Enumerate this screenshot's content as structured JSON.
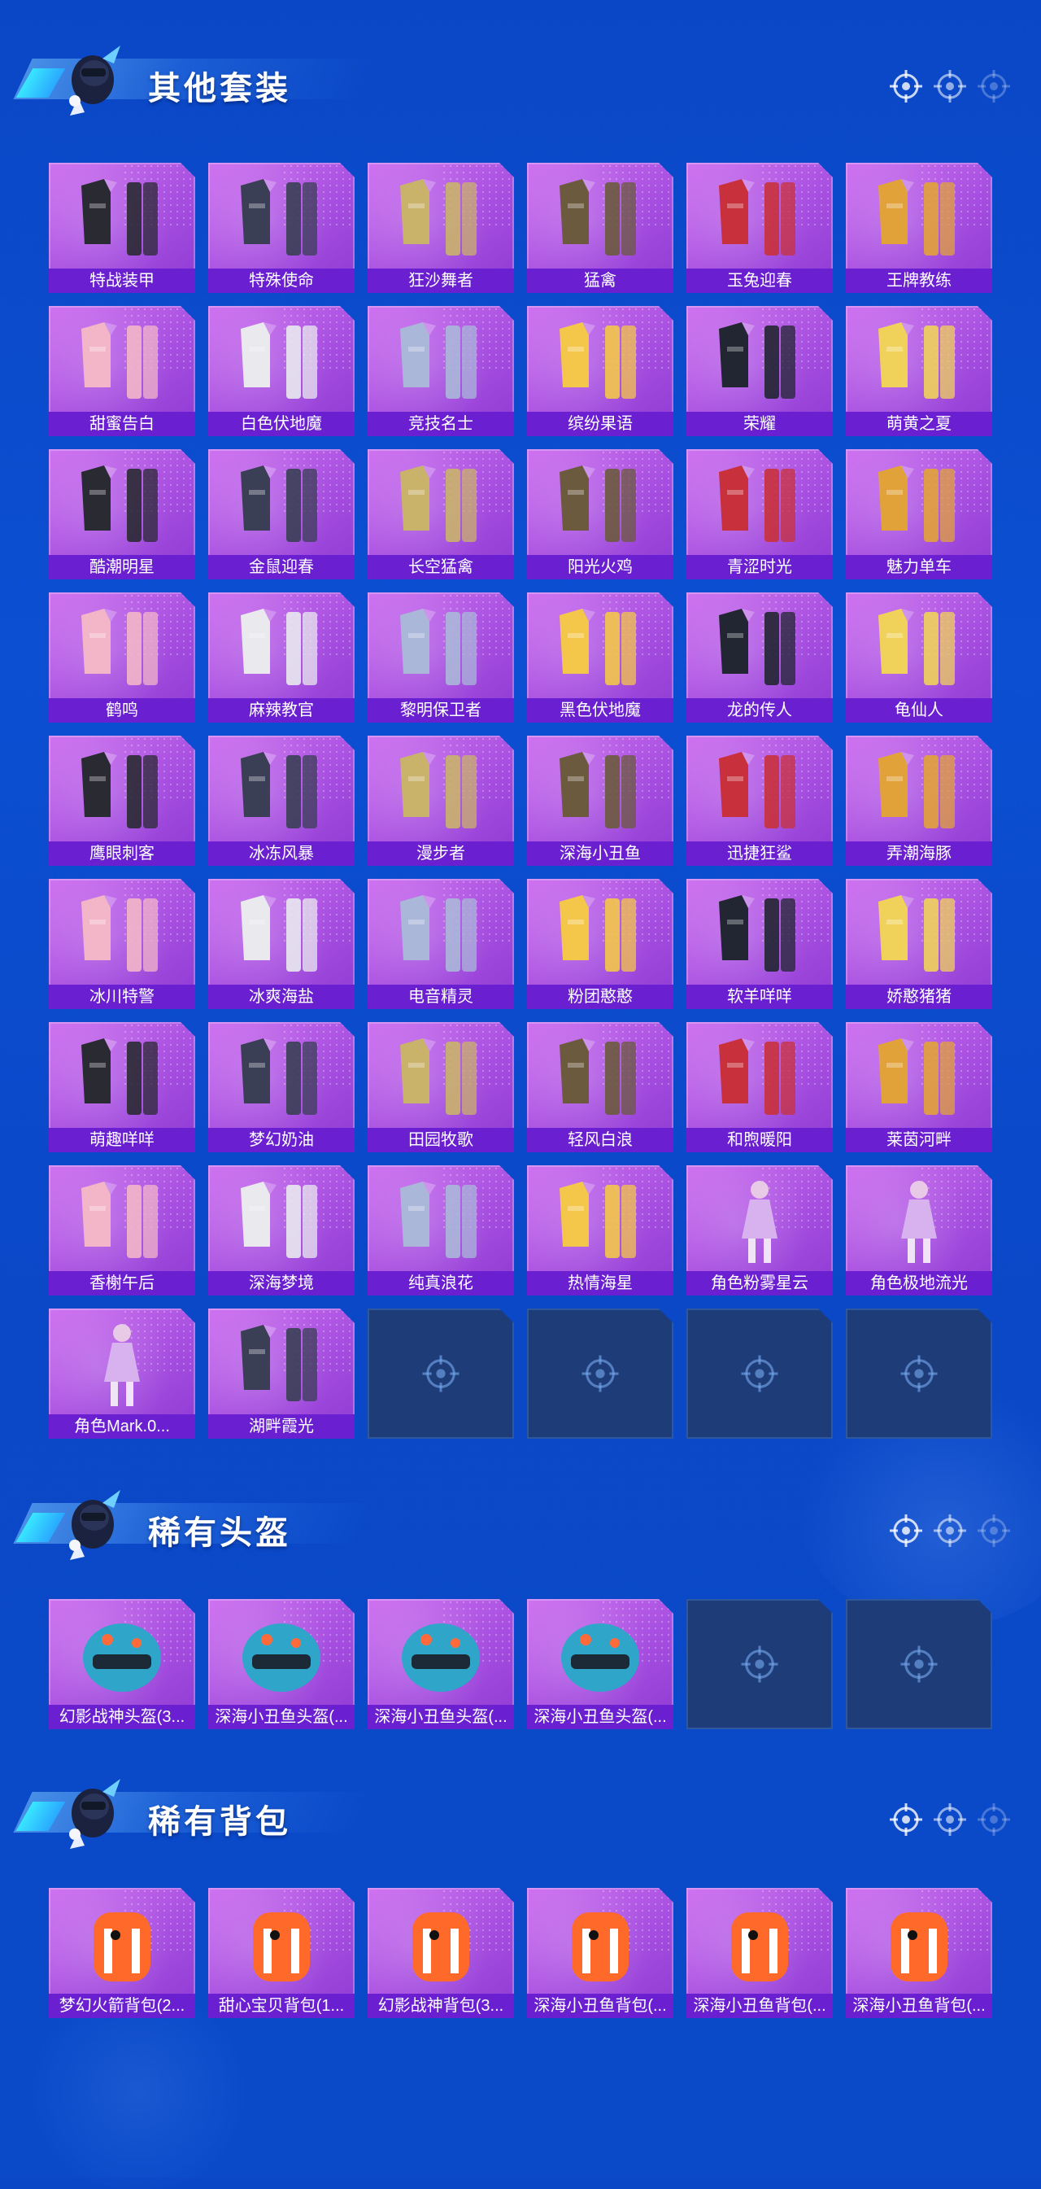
{
  "colors": {
    "page_bg": "#0a47c6",
    "card_purple": "#a64ee0",
    "label_bar": "#6a1fd0",
    "empty_slot": "#1d3c78",
    "accent_cyan": "#39e6ff"
  },
  "sections": [
    {
      "title": "其他套装",
      "items": [
        {
          "label": "特战装甲",
          "icon": "outfit-icon"
        },
        {
          "label": "特殊使命",
          "icon": "outfit-icon"
        },
        {
          "label": "狂沙舞者",
          "icon": "outfit-icon"
        },
        {
          "label": "猛禽",
          "icon": "outfit-icon"
        },
        {
          "label": "玉兔迎春",
          "icon": "outfit-icon"
        },
        {
          "label": "王牌教练",
          "icon": "outfit-icon"
        },
        {
          "label": "甜蜜告白",
          "icon": "outfit-icon"
        },
        {
          "label": "白色伏地魔",
          "icon": "outfit-icon"
        },
        {
          "label": "竞技名士",
          "icon": "outfit-icon"
        },
        {
          "label": "缤纷果语",
          "icon": "outfit-icon"
        },
        {
          "label": "荣耀",
          "icon": "outfit-icon"
        },
        {
          "label": "萌黄之夏",
          "icon": "outfit-icon"
        },
        {
          "label": "酷潮明星",
          "icon": "outfit-icon"
        },
        {
          "label": "金鼠迎春",
          "icon": "outfit-icon"
        },
        {
          "label": "长空猛禽",
          "icon": "outfit-icon"
        },
        {
          "label": "阳光火鸡",
          "icon": "outfit-icon"
        },
        {
          "label": "青涩时光",
          "icon": "outfit-icon"
        },
        {
          "label": "魅力单车",
          "icon": "outfit-icon"
        },
        {
          "label": "鹤鸣",
          "icon": "outfit-icon"
        },
        {
          "label": "麻辣教官",
          "icon": "outfit-icon"
        },
        {
          "label": "黎明保卫者",
          "icon": "outfit-icon"
        },
        {
          "label": "黑色伏地魔",
          "icon": "outfit-icon"
        },
        {
          "label": "龙的传人",
          "icon": "outfit-icon"
        },
        {
          "label": "龟仙人",
          "icon": "outfit-icon"
        },
        {
          "label": "鹰眼刺客",
          "icon": "outfit-icon"
        },
        {
          "label": "冰冻风暴",
          "icon": "outfit-icon"
        },
        {
          "label": "漫步者",
          "icon": "outfit-icon"
        },
        {
          "label": "深海小丑鱼",
          "icon": "outfit-icon"
        },
        {
          "label": "迅捷狂鲨",
          "icon": "outfit-icon"
        },
        {
          "label": "弄潮海豚",
          "icon": "outfit-icon"
        },
        {
          "label": "冰川特警",
          "icon": "outfit-icon"
        },
        {
          "label": "冰爽海盐",
          "icon": "outfit-icon"
        },
        {
          "label": "电音精灵",
          "icon": "outfit-icon"
        },
        {
          "label": "粉团憨憨",
          "icon": "outfit-icon"
        },
        {
          "label": "软羊咩咩",
          "icon": "outfit-icon"
        },
        {
          "label": "娇憨猪猪",
          "icon": "outfit-icon"
        },
        {
          "label": "萌趣咩咩",
          "icon": "outfit-icon"
        },
        {
          "label": "梦幻奶油",
          "icon": "outfit-icon"
        },
        {
          "label": "田园牧歌",
          "icon": "outfit-icon"
        },
        {
          "label": "轻风白浪",
          "icon": "outfit-icon"
        },
        {
          "label": "和煦暖阳",
          "icon": "outfit-icon"
        },
        {
          "label": "莱茵河畔",
          "icon": "outfit-icon"
        },
        {
          "label": "香榭午后",
          "icon": "outfit-icon"
        },
        {
          "label": "深海梦境",
          "icon": "outfit-icon"
        },
        {
          "label": "纯真浪花",
          "icon": "outfit-icon"
        },
        {
          "label": "热情海星",
          "icon": "outfit-icon"
        },
        {
          "label": "角色粉雾星云",
          "icon": "character-icon"
        },
        {
          "label": "角色极地流光",
          "icon": "character-icon"
        },
        {
          "label": "角色Mark.0...",
          "icon": "character-icon"
        },
        {
          "label": "湖畔霞光",
          "icon": "outfit-icon"
        }
      ],
      "empty_slots": 4
    },
    {
      "title": "稀有头盔",
      "items": [
        {
          "label": "幻影战神头盔(3...",
          "icon": "helmet-icon"
        },
        {
          "label": "深海小丑鱼头盔(...",
          "icon": "helmet-icon"
        },
        {
          "label": "深海小丑鱼头盔(...",
          "icon": "helmet-icon"
        },
        {
          "label": "深海小丑鱼头盔(...",
          "icon": "helmet-icon"
        }
      ],
      "empty_slots": 2
    },
    {
      "title": "稀有背包",
      "items": [
        {
          "label": "梦幻火箭背包(2...",
          "icon": "backpack-icon"
        },
        {
          "label": "甜心宝贝背包(1...",
          "icon": "backpack-icon"
        },
        {
          "label": "幻影战神背包(3...",
          "icon": "backpack-icon"
        },
        {
          "label": "深海小丑鱼背包(...",
          "icon": "backpack-icon"
        },
        {
          "label": "深海小丑鱼背包(...",
          "icon": "backpack-icon"
        },
        {
          "label": "深海小丑鱼背包(...",
          "icon": "backpack-icon"
        }
      ],
      "empty_slots": 0
    }
  ]
}
